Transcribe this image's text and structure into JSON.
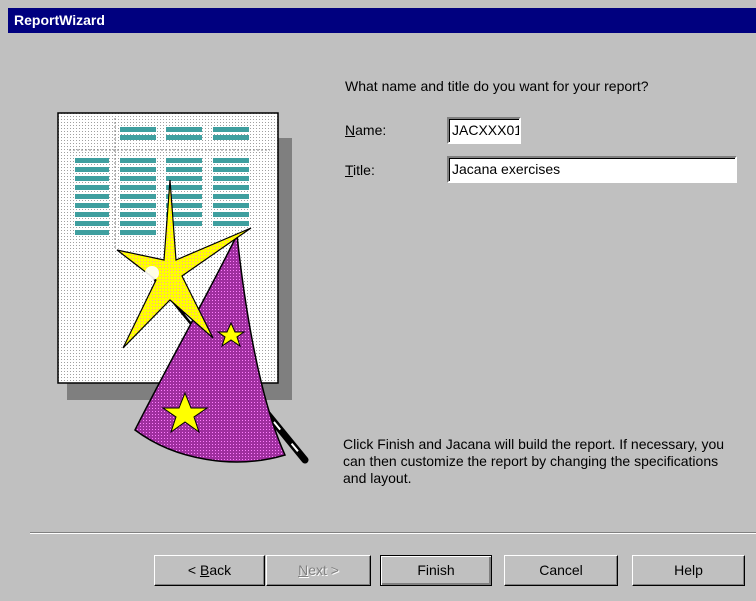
{
  "window": {
    "title": "ReportWizard"
  },
  "form": {
    "prompt": "What name and title do you want for your report?",
    "name": {
      "label_accel": "N",
      "label_rest": "ame:",
      "value": "JACXXX01"
    },
    "title": {
      "label_accel": "T",
      "label_rest": "itle:",
      "value": "Jacana exercises"
    }
  },
  "info_text": "Click Finish and Jacana will build the report.  If necessary, you can then customize the report by changing the specifications and layout.",
  "buttons": {
    "back": {
      "prefix": "< ",
      "accel": "B",
      "rest": "ack"
    },
    "next": {
      "accel": "N",
      "rest": "ext >"
    },
    "finish": "Finish",
    "cancel": "Cancel",
    "help": "Help"
  },
  "illustration": {
    "icon": "report-wizard-icon"
  },
  "colors": {
    "titlebar": "#00007f",
    "dialog": "#c0c0c0",
    "table_cells": "#3f9f9f",
    "star": "#ffff00",
    "hat": "#8f1f8f"
  }
}
